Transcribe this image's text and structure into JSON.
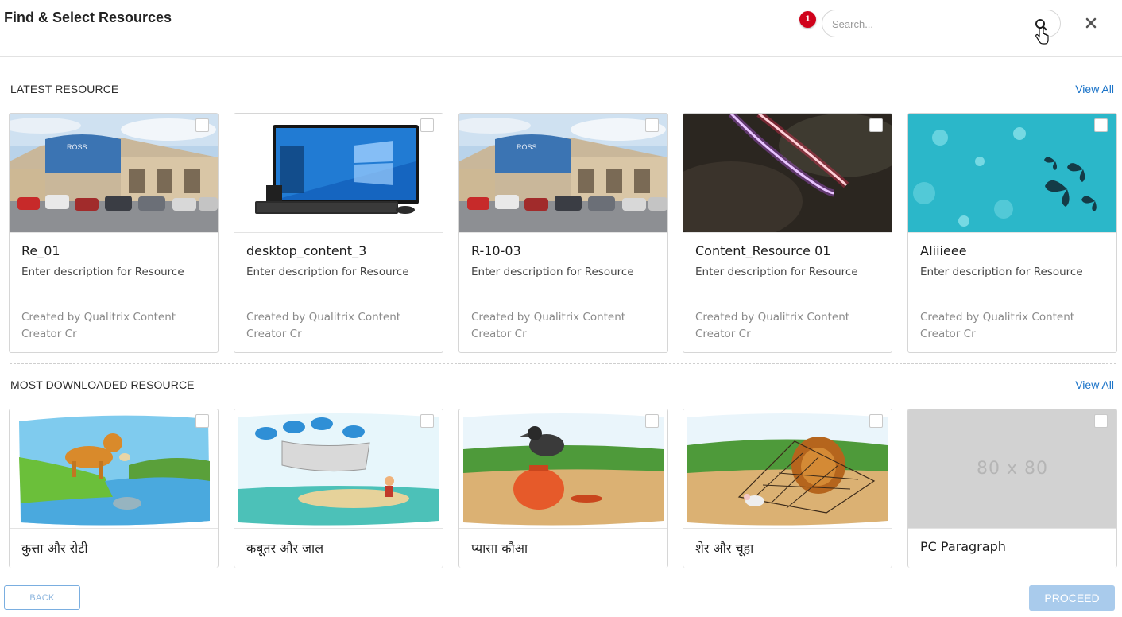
{
  "header": {
    "title": "Find & Select Resources",
    "notification_count": "1",
    "search_placeholder": "Search..."
  },
  "latest": {
    "title": "LATEST RESOURCE",
    "view_all": "View All",
    "cards": [
      {
        "name": "Re_01",
        "description": "Enter description for Resource",
        "author": "Created by Qualitrix Content Creator Cr",
        "thumb": "store-photo"
      },
      {
        "name": "desktop_content_3",
        "description": "Enter description for Resource",
        "author": "Created by Qualitrix Content Creator Cr",
        "thumb": "desktop-computer"
      },
      {
        "name": "R-10-03",
        "description": "Enter description for Resource",
        "author": "Created by Qualitrix Content Creator Cr",
        "thumb": "store-photo"
      },
      {
        "name": "Content_Resource 01",
        "description": "Enter description for Resource",
        "author": "Created by Qualitrix Content Creator Cr",
        "thumb": "neon-light"
      },
      {
        "name": "AIiiieee",
        "description": "Enter description for Resource",
        "author": "Created by Qualitrix Content Creator Cr",
        "thumb": "butterflies"
      }
    ]
  },
  "most_downloaded": {
    "title": "MOST DOWNLOADED RESOURCE",
    "view_all": "View All",
    "cards": [
      {
        "name": "कुत्ता और रोटी",
        "thumb": "dog-illustration"
      },
      {
        "name": "कबूतर और जाल",
        "thumb": "pigeons-illustration"
      },
      {
        "name": "प्यासा कौआ",
        "thumb": "crow-illustration"
      },
      {
        "name": "शेर और चूहा",
        "thumb": "lion-illustration"
      },
      {
        "name": "PC Paragraph",
        "thumb": "placeholder",
        "placeholder_text": "80 x 80"
      }
    ]
  },
  "footer": {
    "back_label": "BACK",
    "proceed_label": "PROCEED"
  },
  "colors": {
    "accent": "#1a73c8",
    "badge": "#d0021b",
    "proceed_disabled": "#a9cbec"
  }
}
